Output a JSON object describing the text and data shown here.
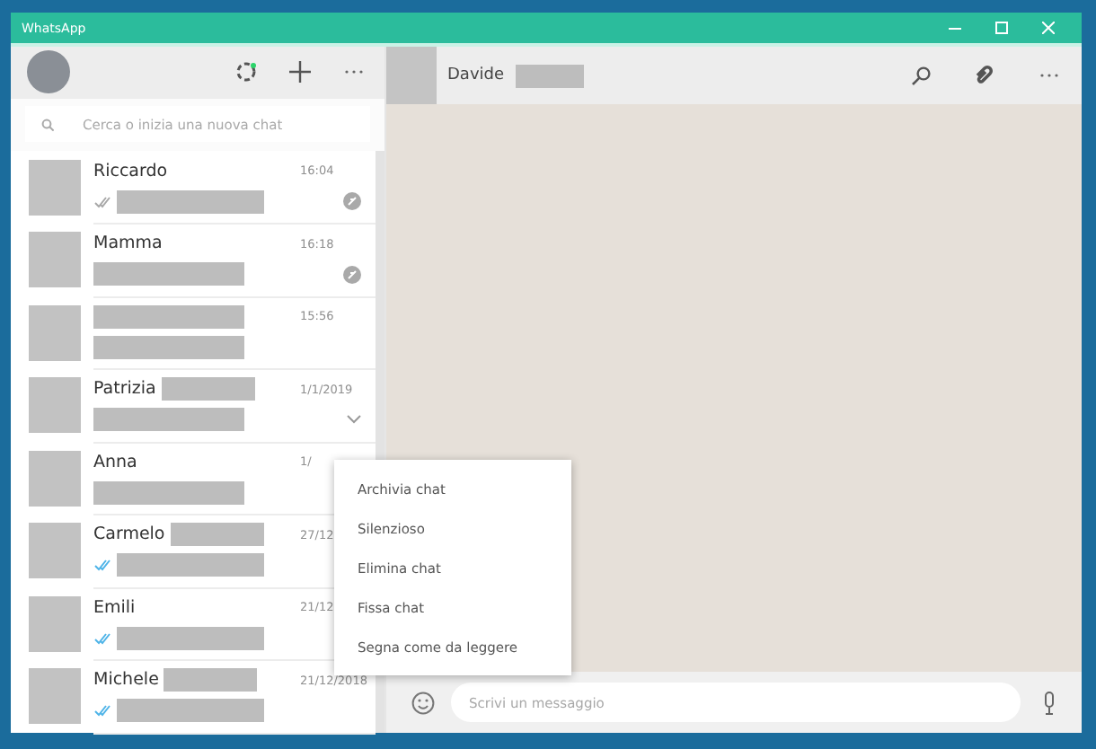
{
  "window": {
    "title": "WhatsApp"
  },
  "search": {
    "placeholder": "Cerca o inizia una nuova chat"
  },
  "chats": [
    {
      "name": "Riccardo",
      "name_redacted": false,
      "time": "16:04",
      "ticks": true,
      "read": false,
      "muted": true,
      "expand": false
    },
    {
      "name": "Mamma",
      "name_redacted": false,
      "time": "16:18",
      "ticks": false,
      "read": false,
      "muted": true,
      "expand": false
    },
    {
      "name_redacted": true,
      "time": "15:56",
      "ticks": false,
      "read": false,
      "muted": false,
      "expand": false
    },
    {
      "name": "Patrizia",
      "name_redacted": true,
      "time": "1/1/2019",
      "ticks": false,
      "read": false,
      "muted": false,
      "expand": true
    },
    {
      "name": "Anna",
      "name_redacted": false,
      "time": "1/",
      "ticks": false,
      "read": false,
      "muted": false,
      "expand": false
    },
    {
      "name": "Carmelo",
      "name_redacted": true,
      "time": "27/12",
      "ticks": true,
      "read": true,
      "muted": false,
      "expand": false
    },
    {
      "name": "Emili",
      "name_redacted": false,
      "time": "21/12",
      "ticks": true,
      "read": true,
      "muted": false,
      "expand": false
    },
    {
      "name": "Michele",
      "name_redacted": true,
      "time": "21/12/2018",
      "ticks": true,
      "read": true,
      "muted": false,
      "expand": false
    }
  ],
  "conversation": {
    "contact": "Davide",
    "contact_redacted": true
  },
  "context_menu": [
    "Archivia chat",
    "Silenzioso",
    "Elimina chat",
    "Fissa chat",
    "Segna come da leggere"
  ],
  "composer": {
    "placeholder": "Scrivi un messaggio"
  }
}
